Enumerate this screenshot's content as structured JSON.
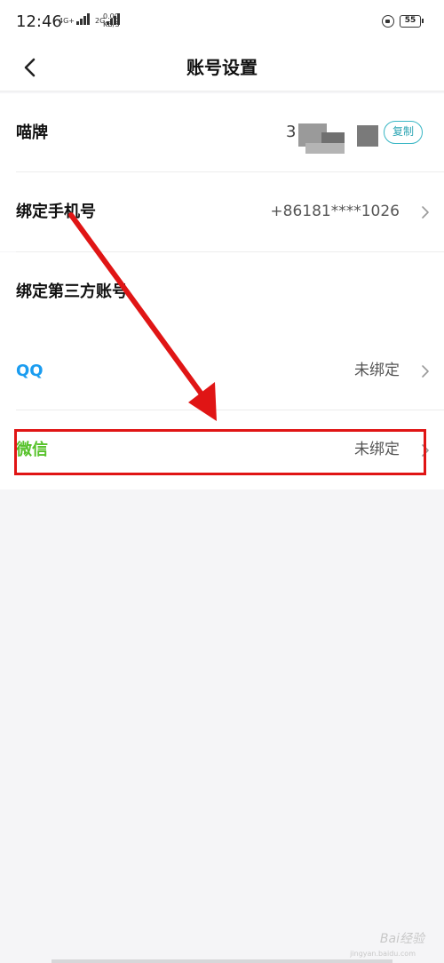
{
  "status_bar": {
    "time": "12:46",
    "net_primary": "4G+",
    "net_secondary": "2G",
    "speed_value": "0.00",
    "speed_unit": "KB/S",
    "battery": "55",
    "lock_icon": "lock-rotation-icon"
  },
  "nav": {
    "title": "账号设置",
    "back_icon": "back-chevron-icon"
  },
  "account": {
    "nickname_label": "喵牌",
    "nickname_value_prefix": "3",
    "copy_button": "复制",
    "phone_label": "绑定手机号",
    "phone_value": "+86181****1026",
    "third_party_header": "绑定第三方账号",
    "qq_label": "QQ",
    "qq_status": "未绑定",
    "wechat_label": "微信",
    "wechat_status": "未绑定"
  },
  "colors": {
    "qq": "#1a9cf0",
    "wechat": "#57c22b",
    "copy_accent": "#38b6c4",
    "annotation_red": "#e01515"
  },
  "watermark": {
    "brand": "Bai经验",
    "sub": "jingyan.baidu.com"
  }
}
